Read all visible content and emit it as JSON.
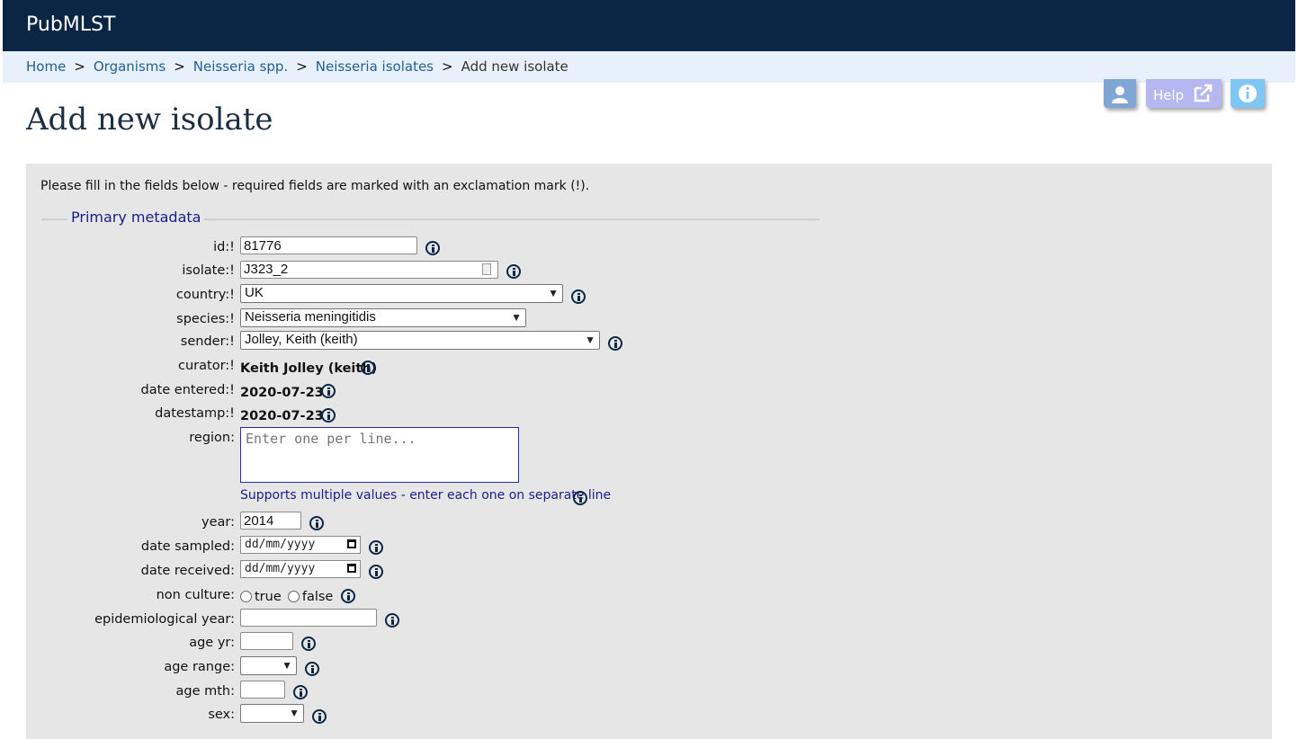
{
  "app": {
    "brand": "PubMLST"
  },
  "breadcrumb": {
    "items": [
      "Home",
      "Organisms",
      "Neisseria spp.",
      "Neisseria isolates"
    ],
    "separator": ">",
    "current": "Add new isolate"
  },
  "toolbar": {
    "help_label": "Help"
  },
  "page": {
    "title": "Add new isolate"
  },
  "form": {
    "intro": "Please fill in the fields below - required fields are marked with an exclamation mark (!).",
    "legend": "Primary metadata",
    "fields": {
      "id": {
        "label": "id:!",
        "value": "81776"
      },
      "isolate": {
        "label": "isolate:!",
        "value": "J323_2"
      },
      "country": {
        "label": "country:!",
        "value": "UK"
      },
      "species": {
        "label": "species:!",
        "value": "Neisseria meningitidis"
      },
      "sender": {
        "label": "sender:!",
        "value": "Jolley, Keith (keith)"
      },
      "curator": {
        "label": "curator:!",
        "value": "Keith Jolley (keith)"
      },
      "date_entered": {
        "label": "date entered:!",
        "value": "2020-07-23"
      },
      "datestamp": {
        "label": "datestamp:!",
        "value": "2020-07-23"
      },
      "region": {
        "label": "region:",
        "placeholder": "Enter one per line...",
        "hint": "Supports multiple values - enter each one on separate line"
      },
      "year": {
        "label": "year:",
        "value": "2014"
      },
      "date_sampled": {
        "label": "date sampled:",
        "placeholder": "dd/mm/yyyy"
      },
      "date_received": {
        "label": "date received:",
        "placeholder": "dd/mm/yyyy"
      },
      "non_culture": {
        "label": "non culture:",
        "options": [
          "true",
          "false"
        ]
      },
      "epidemiological_year": {
        "label": "epidemiological year:",
        "value": ""
      },
      "age_yr": {
        "label": "age yr:",
        "value": ""
      },
      "age_range": {
        "label": "age range:",
        "value": ""
      },
      "age_mth": {
        "label": "age mth:",
        "value": ""
      },
      "sex": {
        "label": "sex:",
        "value": ""
      }
    }
  },
  "colors": {
    "header_bg": "#0b2544",
    "breadcrumb_bg": "#e8f1fb",
    "panel_bg": "#e6e6e6",
    "legend_text": "#1c1c8c",
    "link": "#1f5f96"
  }
}
